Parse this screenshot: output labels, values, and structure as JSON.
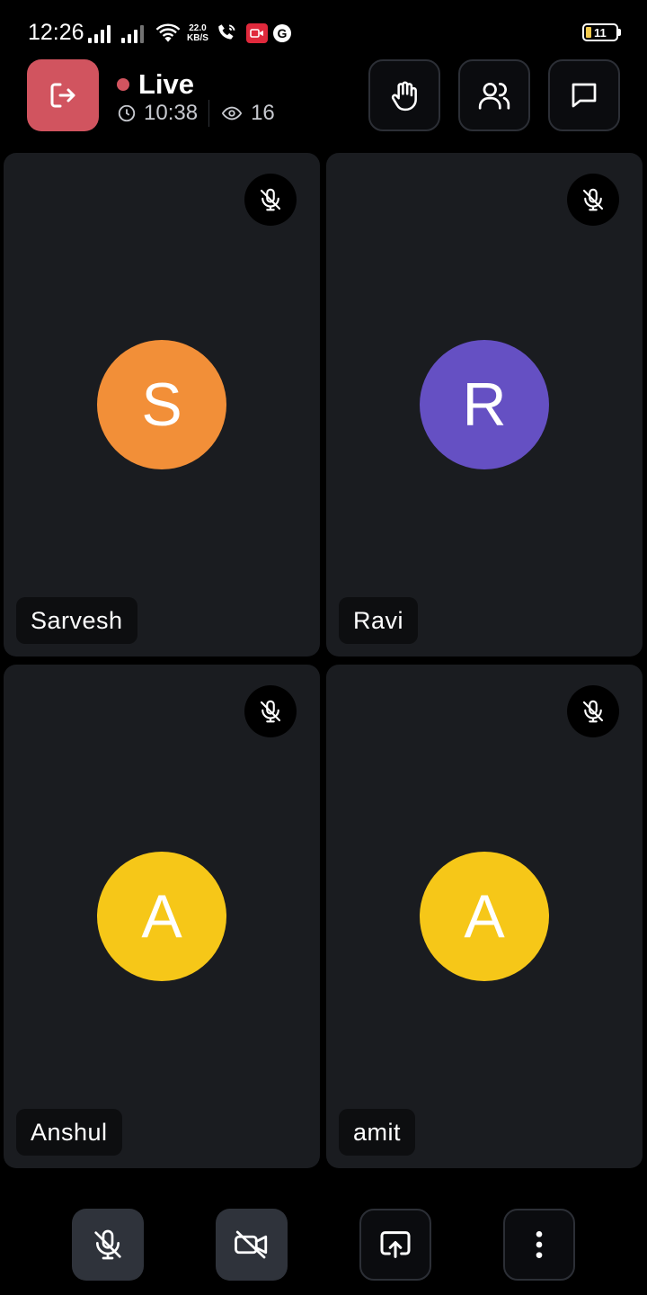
{
  "status_bar": {
    "time": "12:26",
    "speed_value": "22.0",
    "speed_unit": "KB/S",
    "battery": "11"
  },
  "header": {
    "live_label": "Live",
    "duration": "10:38",
    "viewers": "16",
    "leave_icon": "exit-icon",
    "actions": [
      {
        "icon": "raise-hand-icon"
      },
      {
        "icon": "participants-icon"
      },
      {
        "icon": "chat-icon"
      }
    ],
    "colors": {
      "live_dot": "#d1545f",
      "leave_bg": "#d1545f"
    }
  },
  "participants": [
    {
      "name": "Sarvesh",
      "initial": "S",
      "color": "#f28f38",
      "muted": true
    },
    {
      "name": "Ravi",
      "initial": "R",
      "color": "#6550c3",
      "muted": true
    },
    {
      "name": "Anshul",
      "initial": "A",
      "color": "#f6c718",
      "muted": true
    },
    {
      "name": "amit",
      "initial": "A",
      "color": "#f6c718",
      "muted": true
    }
  ],
  "controls": [
    {
      "icon": "mic-off-icon"
    },
    {
      "icon": "camera-off-icon"
    },
    {
      "icon": "screen-share-icon"
    },
    {
      "icon": "more-options-icon"
    }
  ]
}
